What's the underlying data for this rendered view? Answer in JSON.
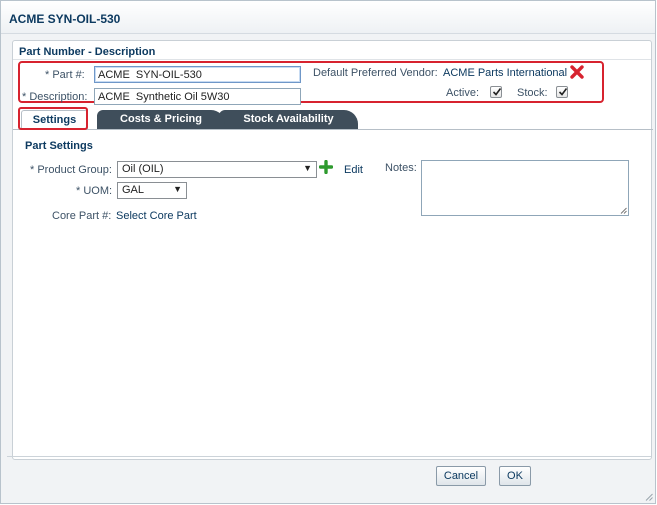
{
  "window": {
    "title": "ACME SYN-OIL-530"
  },
  "part_section": {
    "header": "Part Number - Description",
    "part_number_label": "* Part #:",
    "part_number_value": "ACME  SYN-OIL-530",
    "description_label": "* Description:",
    "description_value": "ACME  Synthetic Oil 5W30",
    "vendor_label": "Default Preferred Vendor:",
    "vendor_value": "ACME Parts International",
    "active_label": "Active:",
    "active_checked": true,
    "stock_label": "Stock:",
    "stock_checked": true
  },
  "tabs": [
    {
      "label": "Settings",
      "active": true
    },
    {
      "label": "Costs & Pricing",
      "active": false
    },
    {
      "label": "Stock Availability",
      "active": false
    }
  ],
  "settings": {
    "section_title": "Part Settings",
    "product_group_label": "* Product Group:",
    "product_group_value": "Oil (OIL)",
    "edit_label": "Edit",
    "uom_label": "* UOM:",
    "uom_value": "GAL",
    "core_part_label": "Core Part #:",
    "core_part_link": "Select Core Part",
    "notes_label": "Notes:",
    "notes_value": ""
  },
  "footer": {
    "cancel_label": "Cancel",
    "ok_label": "OK"
  },
  "colors": {
    "highlight": "#d7232f",
    "heading": "#0d3a60",
    "tab_dark": "#3f4e5b",
    "add_green": "#2e9a2e"
  },
  "icons": [
    "remove-vendor-icon",
    "checkbox-check-icon",
    "add-icon",
    "dropdown-arrow-icon",
    "resize-grip-icon"
  ]
}
